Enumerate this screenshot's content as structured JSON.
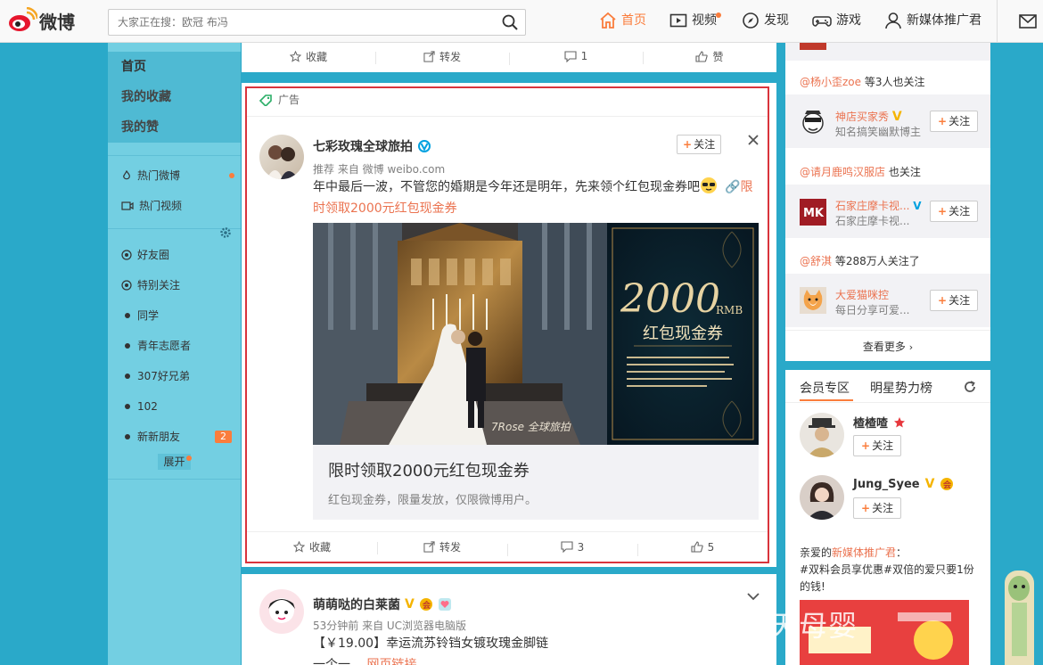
{
  "header": {
    "logo_text": "微博",
    "search_placeholder": "大家正在搜：欧冠 布冯",
    "nav": [
      {
        "label": "首页",
        "icon": "home-icon"
      },
      {
        "label": "视频",
        "icon": "video-icon"
      },
      {
        "label": "发现",
        "icon": "compass-icon"
      },
      {
        "label": "游戏",
        "icon": "gamepad-icon"
      },
      {
        "label": "新媒体推广君",
        "icon": "user-icon"
      }
    ]
  },
  "sidebar": {
    "main": [
      "首页",
      "我的收藏",
      "我的赞"
    ],
    "items1": [
      "热门微博",
      "热门视频"
    ],
    "groups": [
      "好友圈",
      "特别关注",
      "同学",
      "青年志愿者",
      "307好兄弟",
      "102",
      "新新朋友"
    ],
    "new_friends_count": "2",
    "expand": "展开"
  },
  "feed": {
    "top_actions": {
      "fav": "收藏",
      "repost": "转发",
      "comment": "1",
      "like": "赞"
    },
    "ad": {
      "tag": "广告",
      "name": "七彩玫瑰全球旅拍",
      "follow": "关注",
      "source": "推荐 来自 微博 weibo.com",
      "text": "年中最后一波，不管您的婚期是今年还是明年，先来领个红包现金券吧",
      "link_text": "限时领取2000元红包现金券",
      "image": {
        "big": "2000",
        "unit": "RMB",
        "sub": "红包现金券",
        "brand": "7Rose 全球旅拍"
      },
      "card_title": "限时领取2000元红包现金券",
      "card_desc": "红包现金券，限量发放，仅限微博用户。",
      "actions": {
        "fav": "收藏",
        "repost": "转发",
        "comment": "3",
        "like": "5"
      }
    },
    "post2": {
      "name": "萌萌哒的白莱菌",
      "meta": "53分钟前 来自 UC浏览器电脑版",
      "text": "【￥19.00】幸运流苏铃铛女镀玫瑰金脚链",
      "more": "一个一",
      "link": "网页链接"
    }
  },
  "right": {
    "follow_btn": "关注",
    "rec": [
      {
        "intro_name": "@杨小歪zoe",
        "intro_rest": " 等3人也关注",
        "name": "神店买家秀",
        "desc": "知名搞笑幽默博主"
      },
      {
        "intro_name": "@请月鹿鸣汉服店",
        "intro_rest": " 也关注",
        "name": "石家庄摩卡视...",
        "desc": "石家庄摩卡视..."
      },
      {
        "intro_name": "@舒淇",
        "intro_rest": " 等288万人关注了",
        "name": "大爱猫咪控",
        "desc": "每日分享可爱..."
      }
    ],
    "more": "查看更多",
    "tabs": [
      "会员专区",
      "明星势力榜"
    ],
    "members": [
      {
        "name": "楂楂喳"
      },
      {
        "name": "Jung_Syee"
      }
    ],
    "promo_pre": "亲爱的",
    "promo_name": "新媒体推广君",
    "promo_post": "：",
    "promo_text": "#双料会员享优惠#双倍的爱只要1份的钱!"
  },
  "watermark": "知乎 @刑天母婴"
}
